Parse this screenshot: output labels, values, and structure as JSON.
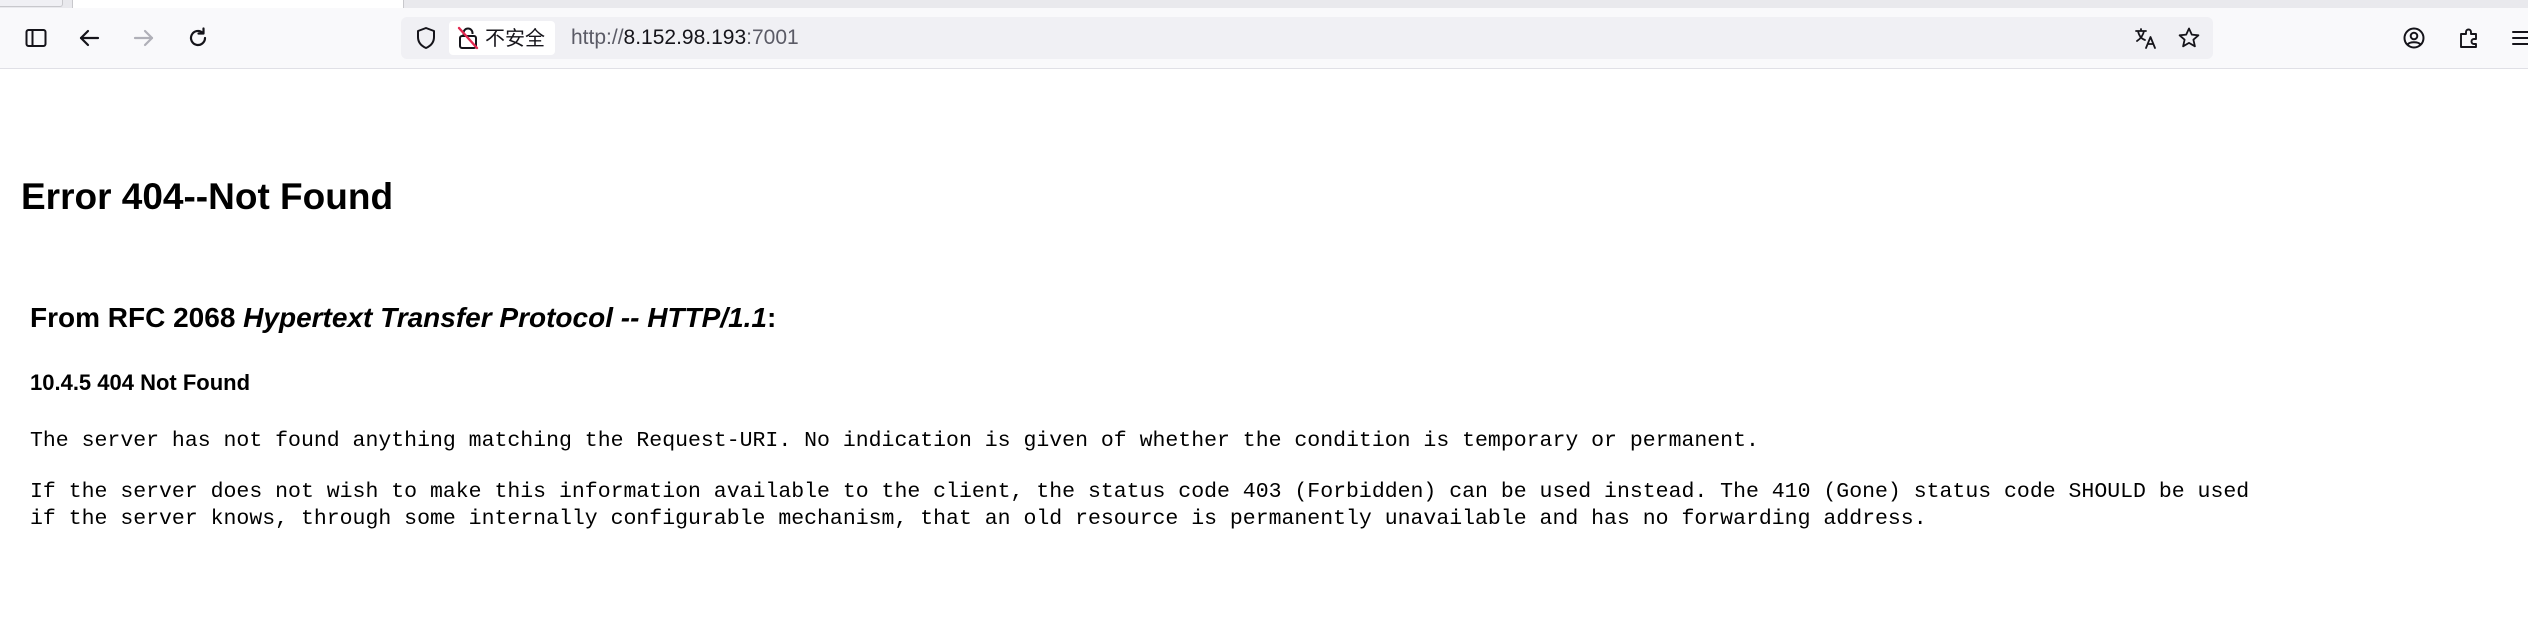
{
  "browser": {
    "url_insecure_label": "不安全",
    "url_scheme": "http://",
    "url_host": "8.152.98.193",
    "url_port": ":7001",
    "icons": {
      "sidebar": "sidebar-icon",
      "back": "back-arrow-icon",
      "forward": "forward-arrow-icon",
      "reload": "reload-icon",
      "tracking": "shield-icon",
      "insecure": "broken-lock-icon",
      "translate": "translate-icon",
      "bookmark": "star-icon",
      "account": "account-icon",
      "extensions": "puzzle-icon",
      "menu": "hamburger-menu-icon"
    }
  },
  "page": {
    "title": "Error 404--Not Found",
    "rfc_prefix": "From RFC 2068 ",
    "rfc_italic": "Hypertext Transfer Protocol -- HTTP/1.1",
    "rfc_suffix": ":",
    "section": "10.4.5 404 Not Found",
    "paragraph1": "The server has not found anything matching the Request-URI. No indication is given of whether the condition is temporary or permanent.",
    "paragraph2_line1": "If the server does not wish to make this information available to the client, the status code 403 (Forbidden) can be used instead. The 410 (Gone) status code SHOULD be used",
    "paragraph2_line2": "if the server knows, through some internally configurable mechanism, that an old resource is permanently unavailable and has no forwarding address."
  },
  "colors": {
    "toolbar_bg": "#f9f9fb",
    "urlbar_bg": "#f0f0f4",
    "icon": "#15141a",
    "icon_disabled": "#b0b0b8",
    "insecure_red": "#e22850",
    "url_dim": "#5b5b66"
  }
}
